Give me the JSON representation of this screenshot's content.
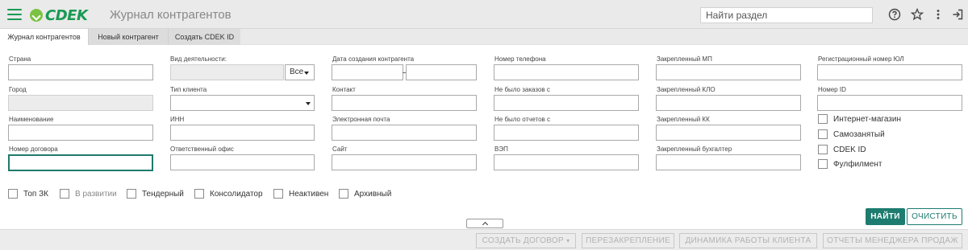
{
  "header": {
    "logo_text": "CDEK",
    "page_title": "Журнал контрагентов",
    "search_placeholder": "Найти раздел"
  },
  "tabs": [
    {
      "label": "Журнал контрагентов"
    },
    {
      "label": "Новый контрагент"
    },
    {
      "label": "Создать CDEK ID"
    }
  ],
  "form": {
    "country": "Страна",
    "city": "Город",
    "name": "Наименование",
    "contract_number": "Номер договора",
    "activity_type": "Вид деятельности:",
    "activity_select_value": "Все",
    "client_type": "Тип клиента",
    "inn": "ИНН",
    "responsible_office": "Ответственный офис",
    "created_date": "Дата создания контрагента",
    "contact": "Контакт",
    "email": "Электронная почта",
    "site": "Сайт",
    "phone": "Номер телефона",
    "no_orders_since": "Не было заказов с",
    "no_reports_since": "Не было отчетов с",
    "vzp": "ВЭП",
    "assigned_mp": "Закрепленный МП",
    "assigned_klo": "Закрепленный КЛО",
    "assigned_kk": "Закрепленный КК",
    "assigned_accountant": "Закрепленный бухгалтер",
    "reg_number": "Регистрационный номер ЮЛ",
    "id_number": "Номер ID"
  },
  "right_checkboxes": [
    {
      "label": "Интернет-магазин"
    },
    {
      "label": "Самозанятый"
    },
    {
      "label": "CDEK ID"
    },
    {
      "label": "Фулфилмент"
    }
  ],
  "bottom_checkboxes": [
    {
      "label": "Топ ЗК"
    },
    {
      "label": "В развитии"
    },
    {
      "label": "Тендерный"
    },
    {
      "label": "Консолидатор"
    },
    {
      "label": "Неактивен"
    },
    {
      "label": "Архивный"
    }
  ],
  "actions": {
    "find": "НАЙТИ",
    "clear": "ОЧИСТИТЬ"
  },
  "footer": {
    "create_contract": "СОЗДАТЬ ДОГОВОР",
    "reassign": "ПЕРЕЗАКРЕПЛЕНИЕ",
    "dynamics": "ДИНАМИКА РАБОТЫ КЛИЕНТА",
    "manager_reports": "ОТЧЕТЫ МЕНЕДЖЕРА ПРОДАЖ"
  },
  "colors": {
    "brand": "#1a9a53",
    "accent": "#1d7c6f"
  }
}
